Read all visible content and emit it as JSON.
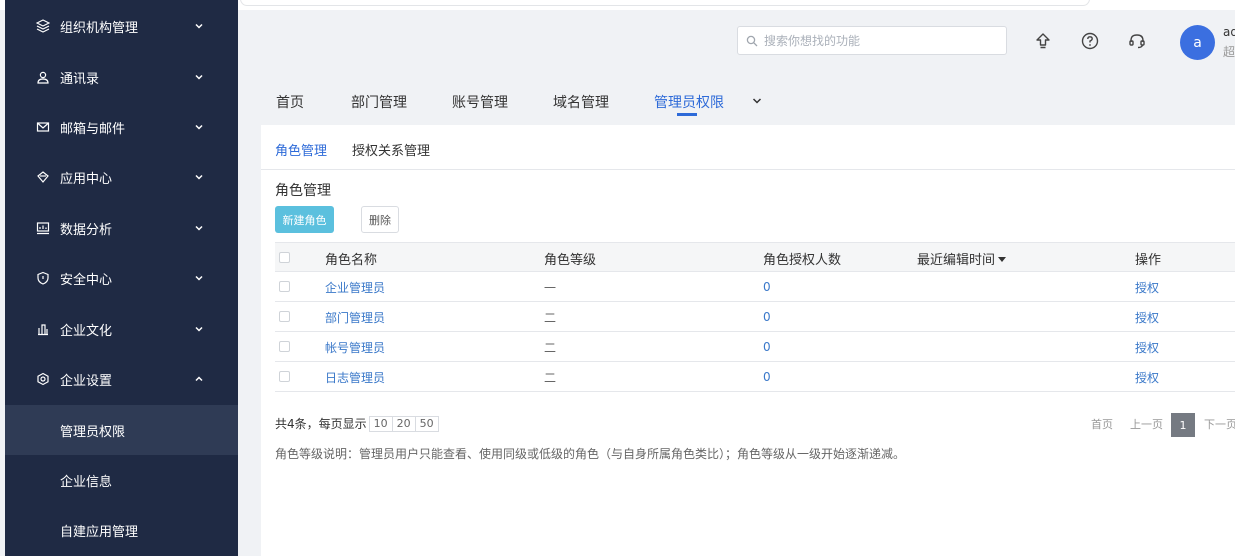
{
  "sidebar": {
    "items": [
      {
        "label": "组织机构管理",
        "icon": "org-icon",
        "expanded": false
      },
      {
        "label": "通讯录",
        "icon": "contacts-icon",
        "expanded": false
      },
      {
        "label": "邮箱与邮件",
        "icon": "mail-icon",
        "expanded": false
      },
      {
        "label": "应用中心",
        "icon": "apps-icon",
        "expanded": false
      },
      {
        "label": "数据分析",
        "icon": "analytics-icon",
        "expanded": false
      },
      {
        "label": "安全中心",
        "icon": "shield-icon",
        "expanded": false
      },
      {
        "label": "企业文化",
        "icon": "culture-icon",
        "expanded": false
      },
      {
        "label": "企业设置",
        "icon": "settings-icon",
        "expanded": true
      }
    ],
    "subitems": [
      {
        "label": "管理员权限",
        "active": true
      },
      {
        "label": "企业信息",
        "active": false
      },
      {
        "label": "自建应用管理",
        "active": false
      }
    ]
  },
  "header": {
    "search_placeholder": "搜索你想找的功能",
    "avatar_letter": "a",
    "user_name": "ad",
    "user_role": "超"
  },
  "main_tabs": [
    {
      "label": "首页",
      "active": false
    },
    {
      "label": "部门管理",
      "active": false
    },
    {
      "label": "账号管理",
      "active": false
    },
    {
      "label": "域名管理",
      "active": false
    },
    {
      "label": "管理员权限",
      "active": true
    }
  ],
  "sub_tabs": [
    {
      "label": "角色管理",
      "active": true
    },
    {
      "label": "授权关系管理",
      "active": false
    }
  ],
  "section": {
    "title": "角色管理",
    "new_button": "新建角色",
    "delete_button": "删除"
  },
  "table": {
    "headers": [
      "角色名称",
      "角色等级",
      "角色授权人数",
      "最近编辑时间",
      "操作"
    ],
    "rows": [
      {
        "name": "企业管理员",
        "level": "一",
        "count": "0",
        "time": "",
        "action": "授权"
      },
      {
        "name": "部门管理员",
        "level": "二",
        "count": "0",
        "time": "",
        "action": "授权"
      },
      {
        "name": "帐号管理员",
        "level": "二",
        "count": "0",
        "time": "",
        "action": "授权"
      },
      {
        "name": "日志管理员",
        "level": "二",
        "count": "0",
        "time": "",
        "action": "授权"
      }
    ]
  },
  "pagination": {
    "summary": "共4条，每页显示",
    "sizes": [
      "10",
      "20",
      "50"
    ],
    "first": "首页",
    "prev": "上一页",
    "current": "1",
    "next": "下一页"
  },
  "note": "角色等级说明：管理员用户只能查看、使用同级或低级的角色（与自身所属角色类比）；角色等级从一级开始逐渐递减。",
  "colors": {
    "sidebar_bg": "#1f2a44",
    "accent": "#2d6ad8",
    "new_button": "#5bc0de",
    "link": "#3a78c9",
    "avatar": "#3b6fe0"
  }
}
